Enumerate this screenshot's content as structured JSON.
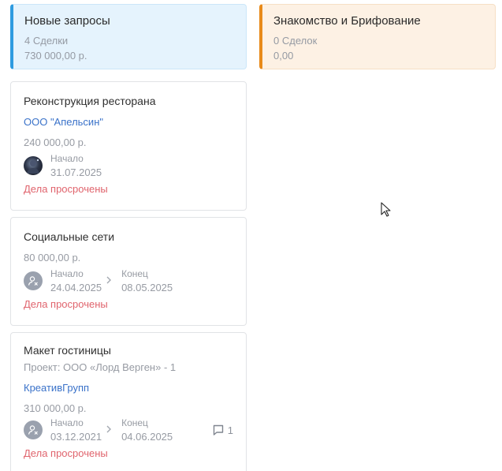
{
  "columns": [
    {
      "title": "Новые запросы",
      "deals": "4 Сделки",
      "sum": "730 000,00 р.",
      "accent": "#2e9be0"
    },
    {
      "title": "Знакомство и Брифование",
      "deals": "0 Сделок",
      "sum": "0,00",
      "accent": "#e88a1a"
    }
  ],
  "cards": [
    {
      "title": "Реконструкция ресторана",
      "company": "ООО \"Апельсин\"",
      "amount": "240 000,00 р.",
      "start_label": "Начало",
      "start_date": "31.07.2025",
      "status": "Дела просрочены"
    },
    {
      "title": "Социальные сети",
      "amount": "80 000,00 р.",
      "start_label": "Начало",
      "start_date": "24.04.2025",
      "end_label": "Конец",
      "end_date": "08.05.2025",
      "status": "Дела просрочены"
    },
    {
      "title": "Макет гостиницы",
      "project": "Проект: ООО «Лорд Верген» - 1",
      "company": "КреативГрупп",
      "amount": "310 000,00 р.",
      "start_label": "Начало",
      "start_date": "03.12.2021",
      "end_label": "Конец",
      "end_date": "04.06.2025",
      "comments": "1",
      "status": "Дела просрочены"
    }
  ],
  "icons": {
    "chevron": "chevron-right-icon",
    "comment": "comment-icon",
    "user": "user-icon",
    "cursor": "mouse-cursor-icon"
  },
  "colors": {
    "overdue": "#e0646d",
    "link": "#3a72c9",
    "muted": "#979ba3"
  }
}
